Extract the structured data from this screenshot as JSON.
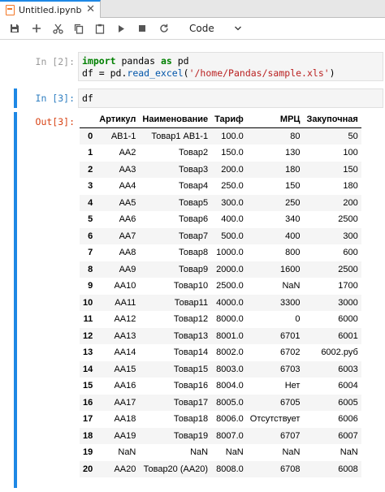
{
  "tab": {
    "title": "Untitled.ipynb",
    "close": "✕"
  },
  "toolbar": {
    "kernel_mode": "Code"
  },
  "cells": [
    {
      "prompt": "In [2]:",
      "lines": [
        {
          "parts": [
            {
              "t": "import",
              "c": "kw"
            },
            {
              "t": " pandas ",
              "c": ""
            },
            {
              "t": "as",
              "c": "kw"
            },
            {
              "t": " pd",
              "c": ""
            }
          ]
        },
        {
          "parts": [
            {
              "t": "df = pd.",
              "c": ""
            },
            {
              "t": "read_excel",
              "c": "fn"
            },
            {
              "t": "(",
              "c": ""
            },
            {
              "t": "'/home/Pandas/sample.xls'",
              "c": "str"
            },
            {
              "t": ")",
              "c": ""
            }
          ]
        }
      ]
    },
    {
      "prompt": "In [3]:",
      "code": "df"
    }
  ],
  "output": {
    "prompt": "Out[3]:",
    "columns": [
      "",
      "Артикул",
      "Наименование",
      "Тариф",
      "МРЦ",
      "Закупочная"
    ],
    "rows": [
      [
        "0",
        "АВ1-1",
        "Товар1 АВ1-1",
        "100.0",
        "80",
        "50"
      ],
      [
        "1",
        "АА2",
        "Товар2",
        "150.0",
        "130",
        "100"
      ],
      [
        "2",
        "АА3",
        "Товар3",
        "200.0",
        "180",
        "150"
      ],
      [
        "3",
        "АА4",
        "Товар4",
        "250.0",
        "150",
        "180"
      ],
      [
        "4",
        "АА5",
        "Товар5",
        "300.0",
        "250",
        "200"
      ],
      [
        "5",
        "АА6",
        "Товар6",
        "400.0",
        "340",
        "2500"
      ],
      [
        "6",
        "АА7",
        "Товар7",
        "500.0",
        "400",
        "300"
      ],
      [
        "7",
        "АА8",
        "Товар8",
        "1000.0",
        "800",
        "600"
      ],
      [
        "8",
        "АА9",
        "Товар9",
        "2000.0",
        "1600",
        "2500"
      ],
      [
        "9",
        "АА10",
        "Товар10",
        "2500.0",
        "NaN",
        "1700"
      ],
      [
        "10",
        "АА11",
        "Товар11",
        "4000.0",
        "3300",
        "3000"
      ],
      [
        "11",
        "АА12",
        "Товар12",
        "8000.0",
        "0",
        "6000"
      ],
      [
        "12",
        "АА13",
        "Товар13",
        "8001.0",
        "6701",
        "6001"
      ],
      [
        "13",
        "АА14",
        "Товар14",
        "8002.0",
        "6702",
        "6002.руб"
      ],
      [
        "14",
        "АА15",
        "Товар15",
        "8003.0",
        "6703",
        "6003"
      ],
      [
        "15",
        "АА16",
        "Товар16",
        "8004.0",
        "Нет",
        "6004"
      ],
      [
        "16",
        "АА17",
        "Товар17",
        "8005.0",
        "6705",
        "6005"
      ],
      [
        "17",
        "АА18",
        "Товар18",
        "8006.0",
        "Отсутствует",
        "6006"
      ],
      [
        "18",
        "АА19",
        "Товар19",
        "8007.0",
        "6707",
        "6007"
      ],
      [
        "19",
        "NaN",
        "NaN",
        "NaN",
        "NaN",
        "NaN"
      ],
      [
        "20",
        "АА20",
        "Товар20 (АА20)",
        "8008.0",
        "6708",
        "6008"
      ]
    ]
  },
  "colors": {
    "accent": "#1e88e5",
    "notebook_icon": "#f37726",
    "in_prompt": "#307fc1",
    "out_prompt": "#d84315"
  }
}
